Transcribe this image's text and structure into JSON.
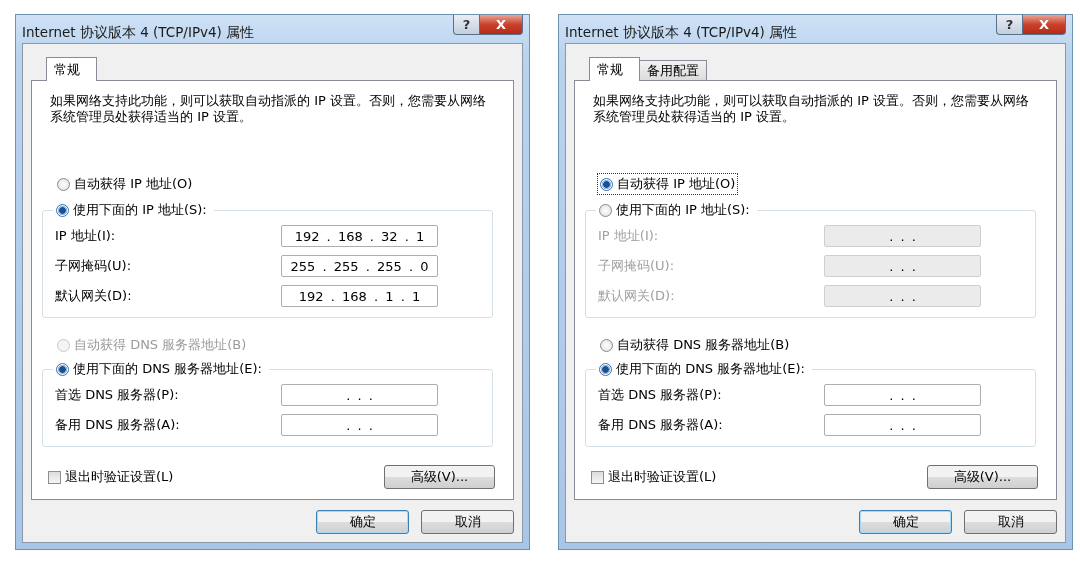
{
  "dialogs": [
    {
      "title": "Internet 协议版本 4 (TCP/IPv4) 属性",
      "help": "?",
      "close": "X",
      "tabs": [
        {
          "label": "常规",
          "selected": true
        }
      ],
      "description": "如果网络支持此功能，则可以获取自动指派的 IP 设置。否则，您需要从网络系统管理员处获得适当的 IP 设置。",
      "ip_auto": {
        "label": "自动获得 IP 地址(O)",
        "selected": false,
        "disabled": false,
        "focused": false
      },
      "ip_manual": {
        "label": "使用下面的 IP 地址(S):",
        "selected": true,
        "disabled": false,
        "focused": false
      },
      "ip_fields": [
        {
          "label": "IP 地址(I):",
          "value": "192 . 168 . 32 . 1",
          "disabled": false
        },
        {
          "label": "子网掩码(U):",
          "value": "255 . 255 . 255 . 0",
          "disabled": false
        },
        {
          "label": "默认网关(D):",
          "value": "192 . 168 . 1 . 1",
          "disabled": false
        }
      ],
      "dns_auto": {
        "label": "自动获得 DNS 服务器地址(B)",
        "selected": false,
        "disabled": true,
        "focused": false
      },
      "dns_manual": {
        "label": "使用下面的 DNS 服务器地址(E):",
        "selected": true,
        "disabled": false,
        "focused": false
      },
      "dns_fields": [
        {
          "label": "首选 DNS 服务器(P):",
          "value": ". . .",
          "disabled": false
        },
        {
          "label": "备用 DNS 服务器(A):",
          "value": ". . .",
          "disabled": false
        }
      ],
      "validate": {
        "label": "退出时验证设置(L)",
        "checked": false
      },
      "advanced": "高级(V)...",
      "ok": "确定",
      "cancel": "取消"
    },
    {
      "title": "Internet 协议版本 4 (TCP/IPv4) 属性",
      "help": "?",
      "close": "X",
      "tabs": [
        {
          "label": "常规",
          "selected": true
        },
        {
          "label": "备用配置",
          "selected": false
        }
      ],
      "description": "如果网络支持此功能，则可以获取自动指派的 IP 设置。否则，您需要从网络系统管理员处获得适当的 IP 设置。",
      "ip_auto": {
        "label": "自动获得 IP 地址(O)",
        "selected": true,
        "disabled": false,
        "focused": true
      },
      "ip_manual": {
        "label": "使用下面的 IP 地址(S):",
        "selected": false,
        "disabled": false,
        "focused": false
      },
      "ip_fields": [
        {
          "label": "IP 地址(I):",
          "value": ". . .",
          "disabled": true
        },
        {
          "label": "子网掩码(U):",
          "value": ". . .",
          "disabled": true
        },
        {
          "label": "默认网关(D):",
          "value": ". . .",
          "disabled": true
        }
      ],
      "dns_auto": {
        "label": "自动获得 DNS 服务器地址(B)",
        "selected": false,
        "disabled": false,
        "focused": false
      },
      "dns_manual": {
        "label": "使用下面的 DNS 服务器地址(E):",
        "selected": true,
        "disabled": false,
        "focused": false
      },
      "dns_fields": [
        {
          "label": "首选 DNS 服务器(P):",
          "value": ". . .",
          "disabled": false
        },
        {
          "label": "备用 DNS 服务器(A):",
          "value": ". . .",
          "disabled": false
        }
      ],
      "validate": {
        "label": "退出时验证设置(L)",
        "checked": false
      },
      "advanced": "高级(V)...",
      "ok": "确定",
      "cancel": "取消"
    }
  ]
}
